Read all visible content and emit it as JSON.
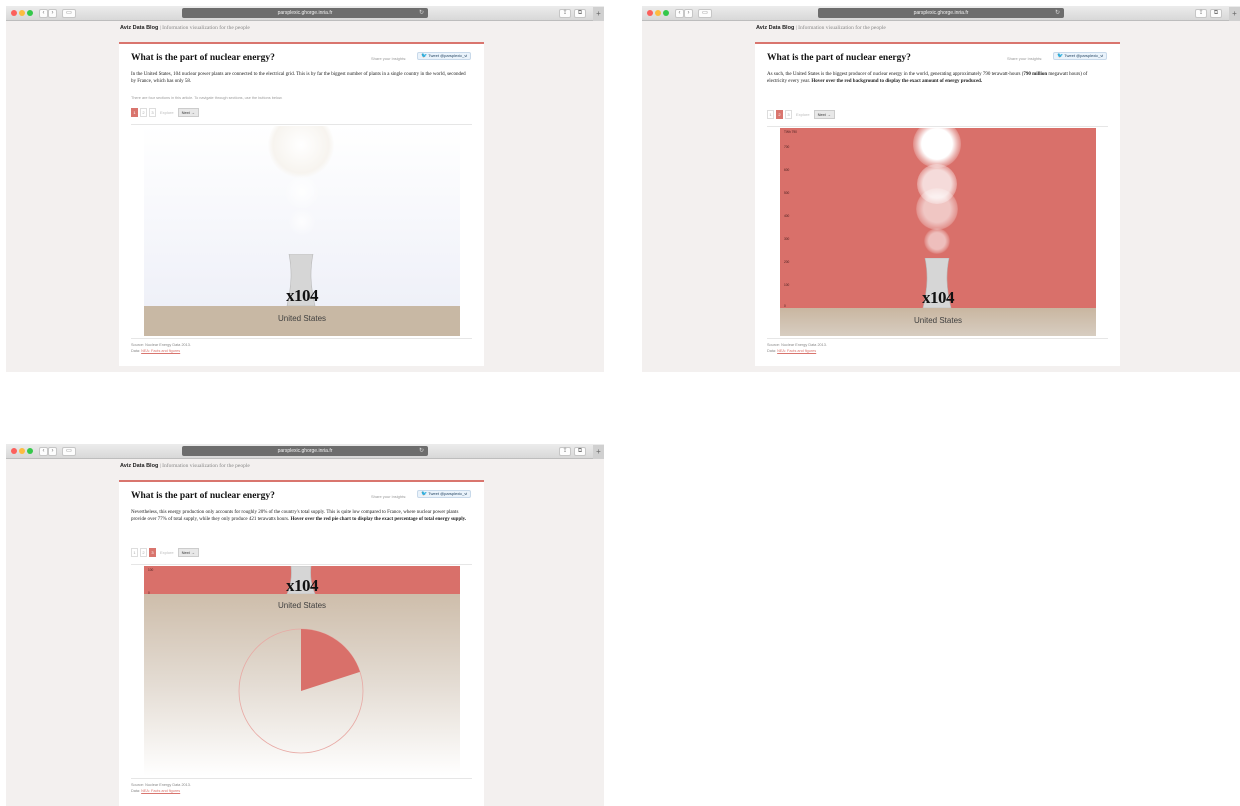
{
  "browser": {
    "url": "parsplexic.ghorge.inria.fr",
    "new_tab": "+"
  },
  "site": {
    "brand": "Aviz Data Blog",
    "tagline": "| Information visualization for the people"
  },
  "article": {
    "title": "What is the part of nuclear energy?",
    "share_label": "Share your insights:",
    "tweet_label": "Tweet @parsplexic_vi",
    "country": "United States",
    "count_label": "x104",
    "source_line": "Source: Nuclear Energy Data 2013.",
    "data_prefix": "Data:",
    "data_link": "NEA: Facts and figures"
  },
  "pager": {
    "pages": [
      "1",
      "2",
      "3"
    ],
    "explore": "Explore",
    "next": "Next →"
  },
  "steps": [
    {
      "active_page": 1,
      "text": "In the United States, 104 nuclear power plants are connected to the electrical grid. This is by far the biggest number of plants in a single country in the world, seconded by France, which has only 58.",
      "note": "There are four sections in this article. To navigate through sections, use the buttons below."
    },
    {
      "active_page": 2,
      "text_a": "As such, the United States is the biggest producer of nuclear energy in the world, generating approximately 790 terawatt-hours (",
      "text_bold_a": "790 million",
      "text_b": " megawatt hours) of electricity every year. ",
      "text_bold_b": "Hover over the red background to display the exact amount of energy produced.",
      "y_axis_title": "TWh",
      "y_ticks": [
        "790",
        "700",
        "600",
        "500",
        "400",
        "300",
        "200",
        "100",
        "0"
      ]
    },
    {
      "active_page": 3,
      "text_a": "Nevertheless, this energy production only accounts for roughly 20% of the country's total supply. This is quite low compared to France, where nuclear power plants provide over 77% of total supply, while they only produce 421 terawatts hours. ",
      "text_bold": "Hover over the red pie chart to display the exact percentage of total energy supply.",
      "y_ticks": [
        "100",
        "0"
      ],
      "nuclear_share": 0.2
    }
  ],
  "colors": {
    "accent": "#d9756e",
    "ground": "#c8b8a4",
    "sky": "#eef0f8"
  }
}
